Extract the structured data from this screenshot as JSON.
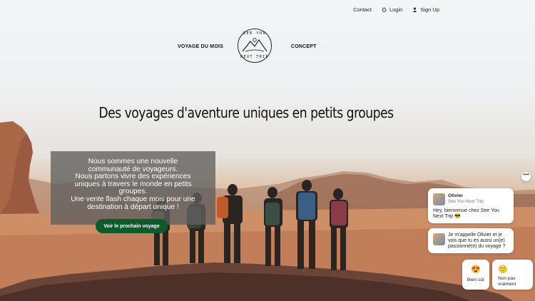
{
  "topbar": {
    "contact": "Contact",
    "login": "Login",
    "signup": "Sign Up"
  },
  "nav": {
    "left": "VOYAGE DU MOIS",
    "right": "CONCEPT"
  },
  "logo": {
    "top": "SEE YOU",
    "bottom": "NEXT TRIP"
  },
  "hero": {
    "headline": "Des voyages d'aventure uniques en petits groupes",
    "intro_lines": [
      "Nous sommes une nouvelle",
      "communauté de voyageurs.",
      "Nous partons vivre des expériences",
      "uniques à travers le monde en petits",
      "groupes.",
      "Une vente flash chaque mois pour une",
      "destination à départ unique !"
    ],
    "cta": "Voir le prochain voyage"
  },
  "chat": {
    "more": "•••",
    "sender": "Olivier",
    "company": "See You Next Trip",
    "message1": "Hey, bienvenue chez See You Next Trip 😎",
    "message2": "Je m'appelle Olivier et je vois que tu es aussi un(e) passionné(e) du voyage ?",
    "reply_yes": {
      "emoji": "😍",
      "label": "Bien sûr"
    },
    "reply_no": {
      "emoji": "🙁",
      "label": "Non pas vraiment"
    }
  },
  "colors": {
    "cta_green": "#0d5b2a",
    "info_box": "#5f5f5f"
  }
}
